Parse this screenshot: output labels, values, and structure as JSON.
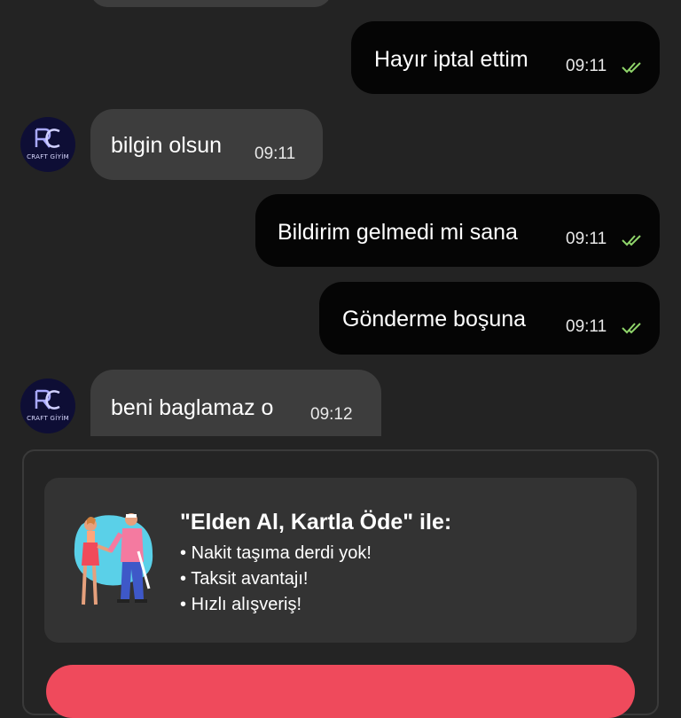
{
  "messages": [
    {
      "id": "m1",
      "dir": "out",
      "text": "Hayır iptal ettim",
      "time": "09:11",
      "read": true
    },
    {
      "id": "m2",
      "dir": "in",
      "text": "bilgin olsun",
      "time": "09:11"
    },
    {
      "id": "m3",
      "dir": "out",
      "text": "Bildirim gelmedi mi sana",
      "time": "09:11",
      "read": true
    },
    {
      "id": "m4",
      "dir": "out",
      "text": "Gönderme boşuna",
      "time": "09:11",
      "read": true
    },
    {
      "id": "m5",
      "dir": "in",
      "text": "beni baglamaz o",
      "time": "09:12"
    }
  ],
  "seller": {
    "avatar_text": "CRAFT GİYİM"
  },
  "promo": {
    "title": "\"Elden Al, Kartla Öde\" ile:",
    "items": [
      "Nakit taşıma derdi yok!",
      "Taksit avantajı!",
      "Hızlı alışveriş!"
    ],
    "illustration_icon": "handshake-illustration"
  },
  "colors": {
    "background": "#232323",
    "incoming_bubble": "#3d3d3d",
    "outgoing_bubble": "#050505",
    "read_tick": "#8fd46a",
    "cta": "#ef4a5c"
  }
}
